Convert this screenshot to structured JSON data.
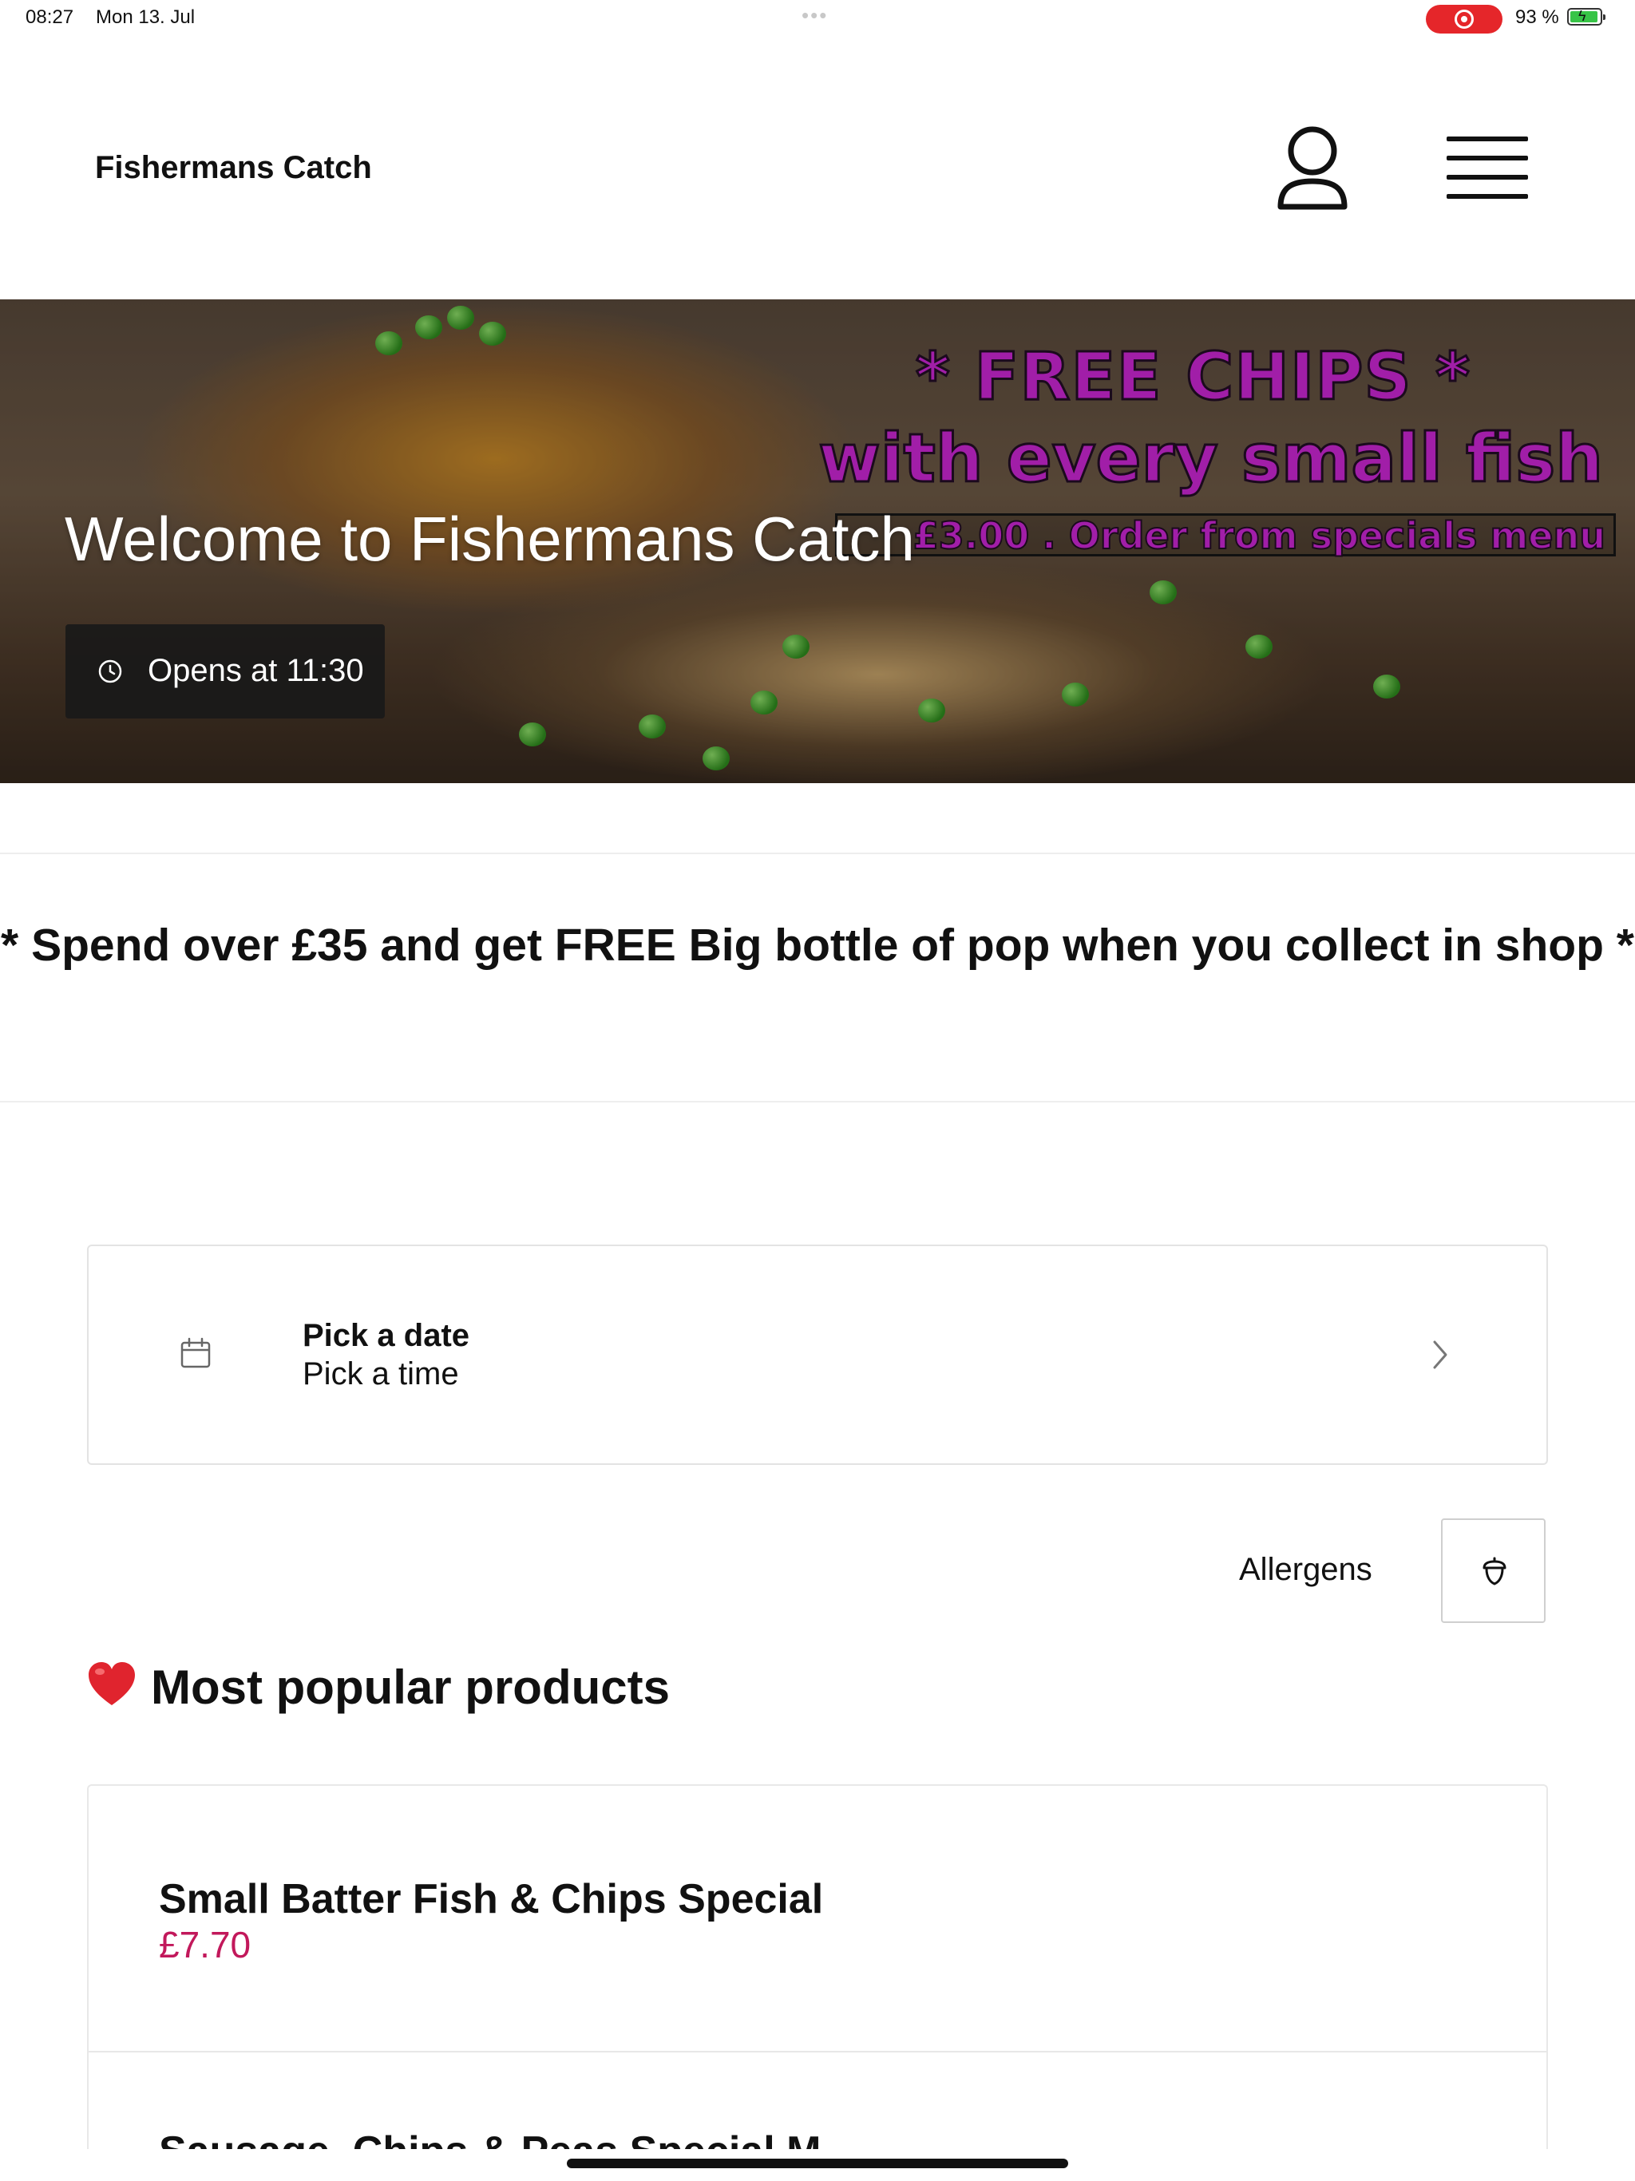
{
  "status_bar": {
    "time": "08:27",
    "date": "Mon 13. Jul",
    "multitask_dots": "•••",
    "battery": "93 %",
    "recording_color": "#e5262a"
  },
  "header": {
    "brand": "Fishermans Catch",
    "account_icon": "user-icon",
    "menu_icon": "hamburger-menu-icon"
  },
  "hero": {
    "title": "Welcome to Fishermans Catch",
    "opens": "Opens at 11:30",
    "promo_line1": "* FREE CHIPS *",
    "promo_line2": "with every small fish",
    "promo_line3": "£3.00 . Order from specials menu"
  },
  "offer_banner": "* Spend over £35 and get FREE Big bottle of pop when you collect in shop *",
  "order_time": {
    "date_label": "Pick a date",
    "time_label": "Pick a time"
  },
  "allergens": {
    "label": "Allergens",
    "icon": "acorn-icon"
  },
  "popular": {
    "title": "Most popular products",
    "icon": "heart-icon",
    "products": [
      {
        "name": "Small Batter Fish & Chips Special",
        "price": "£7.70"
      },
      {
        "name": "Sausage, Chips & Peas Special M..."
      }
    ]
  },
  "colors": {
    "price": "#c2185b",
    "promo": "#a11ea8"
  }
}
